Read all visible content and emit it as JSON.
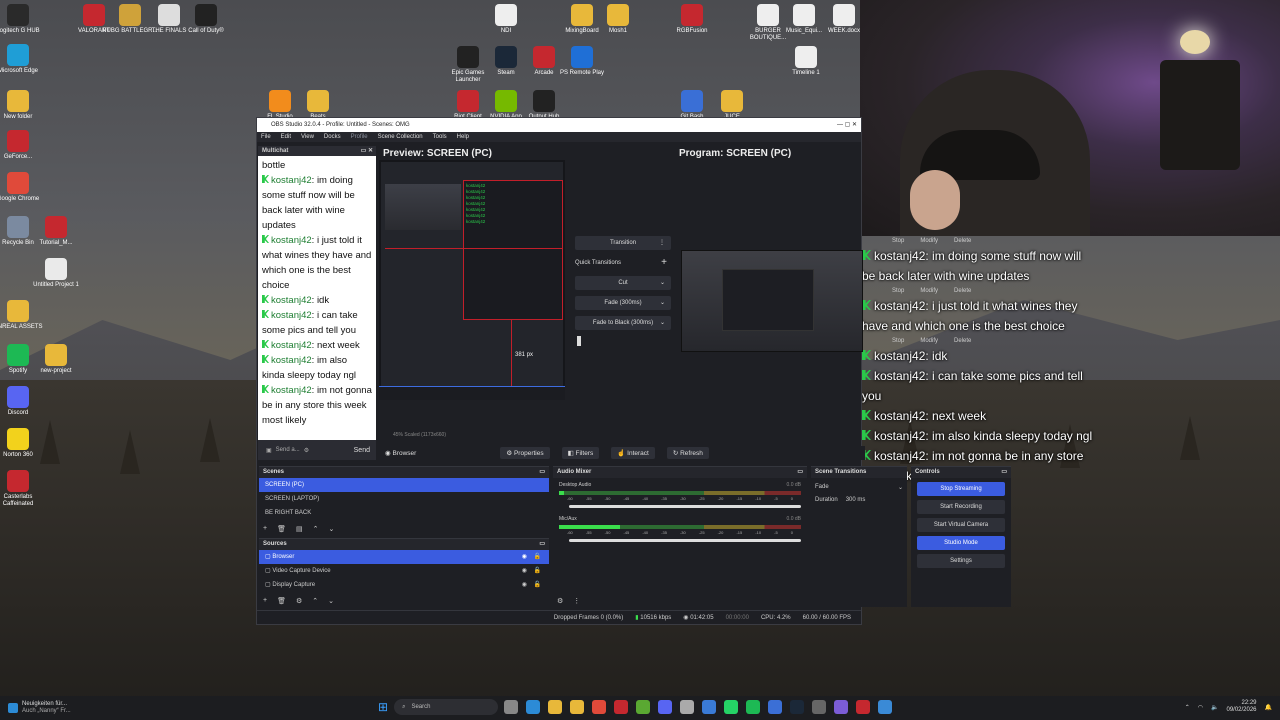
{
  "desktop": {
    "icons_left": [
      {
        "label": "Logitech G HUB",
        "color": "#2a2a2a"
      },
      {
        "label": "Microsoft Edge",
        "color": "#1f9ed6"
      },
      {
        "label": "New folder",
        "color": "#e8b83a"
      },
      {
        "label": "GeForce...",
        "color": "#c5282f"
      },
      {
        "label": "Google Chrome",
        "color": "#e04a3a"
      },
      {
        "label": "Recycle Bin",
        "color": "#7b8aa0"
      },
      {
        "label": "UNREAL ASSETS",
        "color": "#e8b83a"
      },
      {
        "label": "Spotify",
        "color": "#1db954"
      },
      {
        "label": "Discord",
        "color": "#5865f2"
      },
      {
        "label": "Norton 360",
        "color": "#f2d21c"
      },
      {
        "label": "Casterlabs Caffeinated",
        "color": "#c5282f"
      }
    ],
    "icons_col2": [
      {
        "label": "Tutorial_M...",
        "color": "#c5282f"
      },
      {
        "label": "Untitled Project 1",
        "color": "#eaeaea"
      },
      {
        "label": "new-project",
        "color": "#e8b83a"
      }
    ],
    "icons_top": [
      {
        "label": "VALORANT",
        "color": "#c5282f"
      },
      {
        "label": "PUBG BATTLEGR...",
        "color": "#cfa23a"
      },
      {
        "label": "THE FINALS",
        "color": "#ddd"
      },
      {
        "label": "Call of Duty®",
        "color": "#222"
      },
      {
        "label": "NDI",
        "color": "#eee"
      },
      {
        "label": "MixingBoard",
        "color": "#e8b83a"
      },
      {
        "label": "Mosh1",
        "color": "#e8b83a"
      },
      {
        "label": "RGBFusion",
        "color": "#c5282f"
      },
      {
        "label": "BURGER BOUTIQUE...",
        "color": "#eee"
      },
      {
        "label": "Music_Equi...",
        "color": "#eee"
      },
      {
        "label": "WEEK.docx",
        "color": "#eee"
      }
    ],
    "icons_row2": [
      {
        "label": "Epic Games Launcher",
        "color": "#222"
      },
      {
        "label": "Steam",
        "color": "#1b2838"
      },
      {
        "label": "Arcade",
        "color": "#c5282f"
      },
      {
        "label": "PS Remote Play",
        "color": "#1f6fd6"
      },
      {
        "label": "Timeline 1",
        "color": "#eee"
      }
    ],
    "icons_row3": [
      {
        "label": "FL Studio",
        "color": "#f28c1c"
      },
      {
        "label": "Beats",
        "color": "#e8b83a"
      },
      {
        "label": "Riot Client",
        "color": "#c5282f"
      },
      {
        "label": "NVIDIA App",
        "color": "#76b900"
      },
      {
        "label": "Output Hub",
        "color": "#222"
      },
      {
        "label": "Git Bash",
        "color": "#3a6fd6"
      },
      {
        "label": "JUCE",
        "color": "#e8b83a"
      }
    ]
  },
  "overlay": {
    "lines": [
      {
        "user": "kostanj42",
        "text": ": im doing some stuff now will be back later with wine updates"
      },
      {
        "user": "kostanj42",
        "text": ": i just told it what wines they have and which one is the best choice"
      },
      {
        "user": "kostanj42",
        "text": ": idk"
      },
      {
        "user": "kostanj42",
        "text": ": i can take some pics and tell you"
      },
      {
        "user": "kostanj42",
        "text": ": next week"
      },
      {
        "user": "kostanj42",
        "text": ": im also kinda sleepy today ngl"
      },
      {
        "user": "kostanj42",
        "text": ": im not gonna be in any store this week most likely"
      }
    ],
    "ghost_buttons": [
      "Stop",
      "Modify",
      "Delete"
    ],
    "ghost_text": [
      "Start Recording",
      "Start Virtual Camera"
    ]
  },
  "obs": {
    "title": "OBS Studio 32.0.4 - Profile: Untitled - Scenes: OMG",
    "menu": [
      "File",
      "Edit",
      "View",
      "Docks",
      "Profile",
      "Scene Collection",
      "Tools",
      "Help"
    ],
    "multichat": {
      "title": "Multichat",
      "first_line": "bottle",
      "messages": [
        {
          "user": "kostanj42",
          "text": ": im doing some stuff now will be back later with wine updates"
        },
        {
          "user": "kostanj42",
          "text": ": i just told it what wines they have and which one is the best choice"
        },
        {
          "user": "kostanj42",
          "text": ": idk"
        },
        {
          "user": "kostanj42",
          "text": ": i can take some pics and tell you"
        },
        {
          "user": "kostanj42",
          "text": ": next week"
        },
        {
          "user": "kostanj42",
          "text": ": im also kinda sleepy today ngl"
        },
        {
          "user": "kostanj42",
          "text": ": im not gonna be in any store this week most likely"
        }
      ],
      "input_placeholder": "Send a...",
      "send": "Send"
    },
    "preview_title": "Preview: SCREEN (PC)",
    "program_title": "Program: SCREEN (PC)",
    "preview_size": "381 px",
    "preview_status": "45%   Scaled (1173x660)",
    "transition": {
      "button": "Transition",
      "quick": "Quick Transitions",
      "items": [
        "Cut",
        "Fade (300ms)",
        "Fade to Black (300ms)"
      ]
    },
    "source_toolbar": {
      "source": "Browser",
      "buttons": [
        "Properties",
        "Filters",
        "Interact",
        "Refresh"
      ]
    },
    "scenes": {
      "title": "Scenes",
      "items": [
        "SCREEN (PC)",
        "SCREEN (LAPTOP)",
        "BE RIGHT BACK"
      ],
      "selected": 0
    },
    "sources": {
      "title": "Sources",
      "items": [
        "Browser",
        "Video Capture Device",
        "Display Capture"
      ],
      "selected": 0
    },
    "mixer": {
      "title": "Audio Mixer",
      "tracks": [
        {
          "name": "Desktop Audio",
          "db": "0.0 dB",
          "level": 0.02
        },
        {
          "name": "Mic/Aux",
          "db": "0.0 dB",
          "level": 0.25
        }
      ],
      "ticks": [
        "-60",
        "-55",
        "-50",
        "-45",
        "-40",
        "-35",
        "-30",
        "-25",
        "-20",
        "-15",
        "-10",
        "-5",
        "0"
      ]
    },
    "scene_transitions": {
      "title": "Scene Transitions",
      "type": "Fade",
      "duration_label": "Duration",
      "duration": "300 ms"
    },
    "controls": {
      "title": "Controls",
      "buttons": [
        "Stop Streaming",
        "Start Recording",
        "Start Virtual Camera",
        "Studio Mode",
        "Settings"
      ]
    },
    "status": {
      "dropped": "Dropped Frames 0 (0.0%)",
      "bitrate": "10516 kbps",
      "live_time": "01:42:05",
      "rec_time": "00:00:00",
      "cpu": "CPU: 4.2%",
      "fps": "60.00 / 60.00 FPS"
    }
  },
  "taskbar": {
    "news_title": "Neuigkeiten für...",
    "news_sub": "Auch „Nanny“ Fr...",
    "search": "Search",
    "time": "22:29",
    "date": "09/02/2026"
  }
}
